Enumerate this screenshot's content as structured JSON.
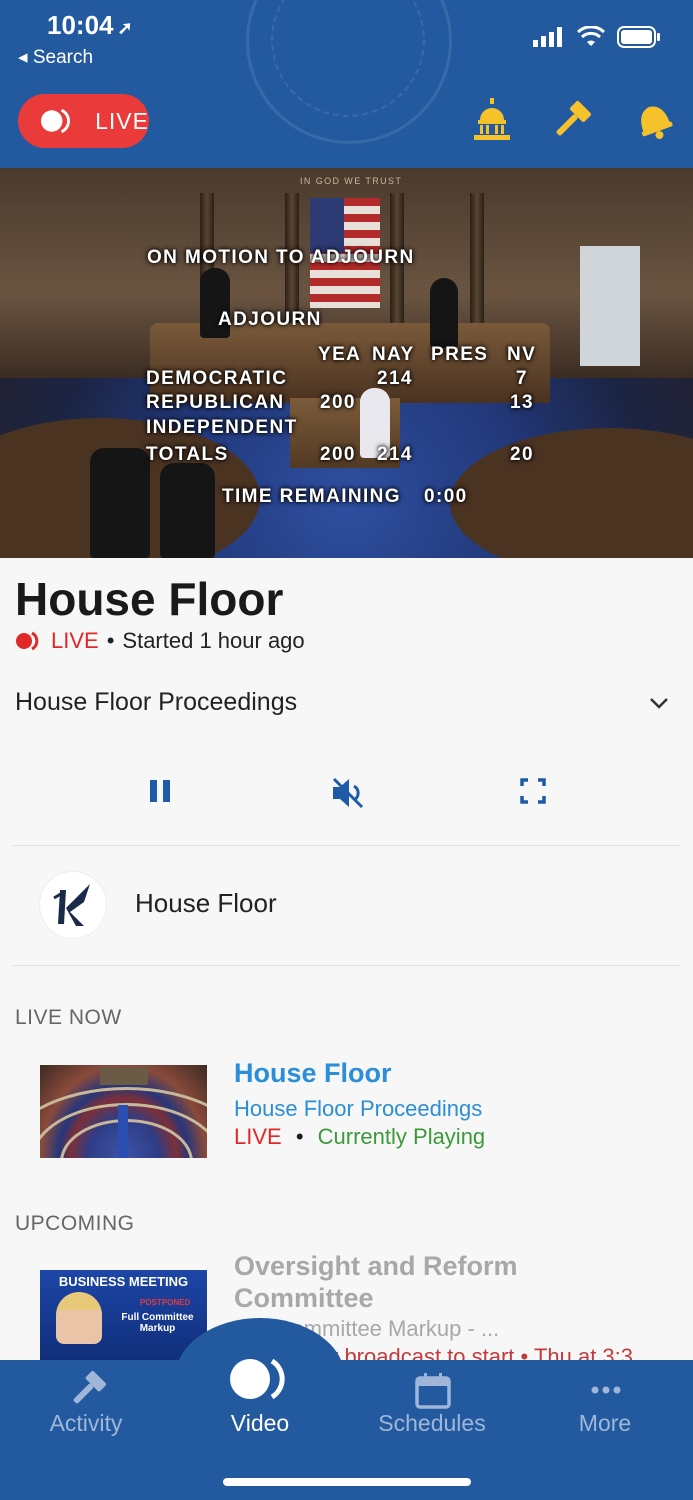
{
  "status_bar": {
    "time": "10:04",
    "back_label": "Search"
  },
  "header": {
    "live_label": "LIVE"
  },
  "video_overlay": {
    "motion": "ON MOTION TO ADJOURN",
    "question": "ADJOURN",
    "columns": [
      "YEA",
      "NAY",
      "PRES",
      "NV"
    ],
    "rows": [
      {
        "party": "DEMOCRATIC",
        "yea": "",
        "nay": "214",
        "pres": "",
        "nv": "7"
      },
      {
        "party": "REPUBLICAN",
        "yea": "200",
        "nay": "",
        "pres": "",
        "nv": "13"
      },
      {
        "party": "INDEPENDENT",
        "yea": "",
        "nay": "",
        "pres": "",
        "nv": ""
      },
      {
        "party": "TOTALS",
        "yea": "200",
        "nay": "214",
        "pres": "",
        "nv": "20"
      }
    ],
    "time_remaining_label": "TIME REMAINING",
    "time_remaining": "0:00",
    "motto": "IN GOD WE TRUST"
  },
  "stream": {
    "title": "House Floor",
    "live_label": "LIVE",
    "started": "Started 1 hour ago",
    "dot": "•",
    "feed_name": "House Floor Proceedings"
  },
  "channel": {
    "name": "House Floor"
  },
  "live_now": {
    "heading": "LIVE NOW",
    "item": {
      "title": "House Floor",
      "subtitle": "House Floor Proceedings",
      "live": "LIVE",
      "dot": "•",
      "status": "Currently Playing"
    }
  },
  "upcoming": {
    "heading": "UPCOMING",
    "item": {
      "title": "Oversight and Reform Committee",
      "subtitle": "Full Committee Markup - ...",
      "status": "Waiting for broadcast to start • Thu at 3:3",
      "thumb_title": "BUSINESS MEETING",
      "thumb_tag": "POSTPONED",
      "thumb_sub": "Full Committee Markup"
    }
  },
  "tabs": [
    {
      "label": "Activity",
      "icon": "gavel-icon"
    },
    {
      "label": "Video",
      "icon": "live-video-icon"
    },
    {
      "label": "Schedules",
      "icon": "calendar-icon"
    },
    {
      "label": "More",
      "icon": "more-icon"
    }
  ],
  "colors": {
    "header_blue": "#235a9f",
    "live_red": "#ea3a3a",
    "link_blue": "#2a8ed8",
    "playing_green": "#3a9a3a",
    "gold": "#f5c22c"
  }
}
